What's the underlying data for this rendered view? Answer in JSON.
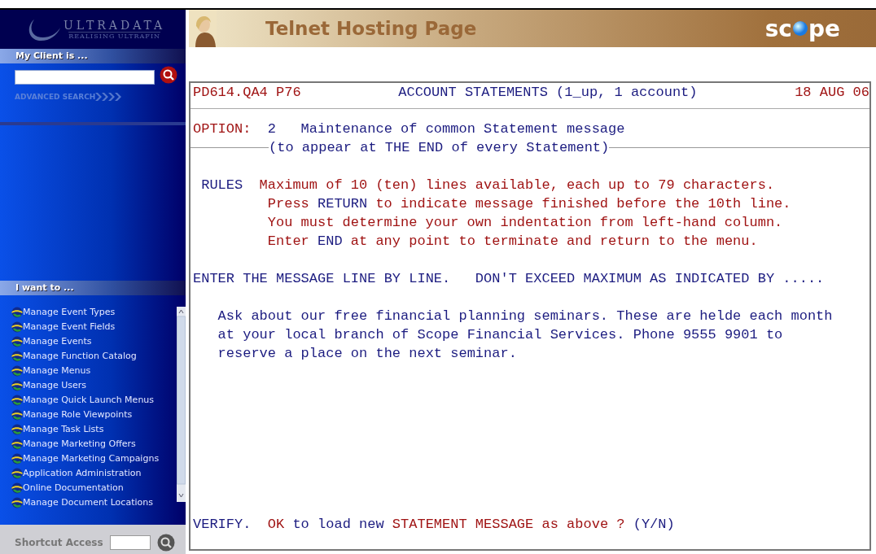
{
  "sidebar": {
    "logo": {
      "name": "ULTRADATA",
      "tagline": "REALISING ULTRAFIN"
    },
    "client_section": {
      "heading": "My Client is ...",
      "advanced_search": "ADVANCED SEARCH"
    },
    "menu_section": {
      "heading": "I want to ...",
      "items": [
        {
          "label": "Manage Event Types"
        },
        {
          "label": "Manage Event Fields"
        },
        {
          "label": "Manage Events"
        },
        {
          "label": "Manage Function Catalog"
        },
        {
          "label": "Manage Menus"
        },
        {
          "label": "Manage Users"
        },
        {
          "label": "Manage Quick Launch Menus"
        },
        {
          "label": "Manage Role Viewpoints"
        },
        {
          "label": "Manage Task Lists"
        },
        {
          "label": "Manage Marketing Offers"
        },
        {
          "label": "Manage Marketing Campaigns"
        },
        {
          "label": "Application Administration"
        },
        {
          "label": "Online Documentation"
        },
        {
          "label": "Manage Document Locations"
        }
      ]
    },
    "shortcut": {
      "label": "Shortcut Access"
    }
  },
  "header": {
    "title": "Telnet Hosting Page",
    "logo": {
      "before": "sc",
      "after": "pe"
    }
  },
  "terminal": {
    "header": {
      "left": "PD614.QA4 P76",
      "title": "ACCOUNT STATEMENTS (1_up, 1 account)",
      "right": "18 AUG 06"
    },
    "option": {
      "label": "OPTION:",
      "number": "2",
      "text": "Maintenance of common Statement message"
    },
    "subtitle": "(to appear at THE END of every Statement)",
    "rules": {
      "label": "RULES",
      "lines": [
        [
          {
            "text": "Maximum of 10 (ten) lines available, each up to 79 characters.",
            "color": "#a01414"
          }
        ],
        [
          {
            "text": "Press ",
            "color": "#a01414"
          },
          {
            "text": "RETURN",
            "color": "#1c1c80"
          },
          {
            "text": " to indicate message finished before the 10th line.",
            "color": "#a01414"
          }
        ],
        [
          {
            "text": "You must determine your own indentation from left-hand column.",
            "color": "#a01414"
          }
        ],
        [
          {
            "text": "Enter ",
            "color": "#a01414"
          },
          {
            "text": "END",
            "color": "#1c1c80"
          },
          {
            "text": " at any point to terminate and return to the menu.",
            "color": "#a01414"
          }
        ]
      ]
    },
    "instruction": "ENTER THE MESSAGE LINE BY LINE.   DON'T EXCEED MAXIMUM AS INDICATED BY .....",
    "message_lines": [
      "Ask about our free financial planning seminars. These are helde each month",
      "at your local branch of Scope Financial Services. Phone 9555 9901 to",
      "reserve a place on the next seminar."
    ],
    "verify": {
      "label": "VERIFY.",
      "segments": [
        {
          "text": "OK",
          "color": "#a01414"
        },
        {
          "text": " to load new ",
          "color": "#1c1c80"
        },
        {
          "text": "STATEMENT MESSAGE",
          "color": "#a01414"
        },
        {
          "text": " as above ? ",
          "color": "#a01414"
        },
        {
          "text": "(Y/N)",
          "color": "#1c1c80"
        }
      ]
    }
  }
}
